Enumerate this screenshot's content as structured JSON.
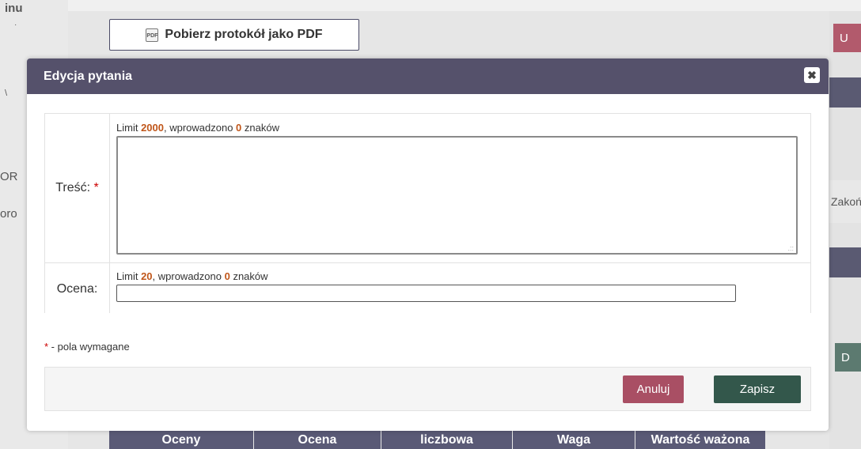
{
  "background": {
    "left_fragments": [
      "inu",
      "·",
      "\\",
      "OR",
      "oro"
    ],
    "pdf_button_label": "Pobierz protokół jako PDF",
    "pdf_icon_text": "PDF",
    "right_button_u": "U",
    "right_button_zakon": "Zakoń",
    "right_button_d": "D",
    "table_headers": [
      "Oceny",
      "Ocena",
      "liczbowa",
      "Waga",
      "Wartość ważona"
    ]
  },
  "modal": {
    "title": "Edycja pytania",
    "close_label": "✖",
    "fields": [
      {
        "label": "Treść:",
        "required_mark": "*",
        "limit_prefix": "Limit ",
        "limit_value": "2000",
        "limit_middle": ", wprowadzono ",
        "entered_value": "0",
        "limit_suffix": " znaków",
        "value": ""
      },
      {
        "label": "Ocena:",
        "limit_prefix": "Limit ",
        "limit_value": "20",
        "limit_middle": ", wprowadzono ",
        "entered_value": "0",
        "limit_suffix": " znaków",
        "value": ""
      }
    ],
    "required_note_star": "*",
    "required_note_text": " - pola wymagane",
    "cancel_label": "Anuluj",
    "save_label": "Zapisz"
  },
  "colors": {
    "header": "#55516b",
    "cancel": "#a94f64",
    "save": "#33574b",
    "limit_number": "#c0561a",
    "required": "#cc0000"
  }
}
